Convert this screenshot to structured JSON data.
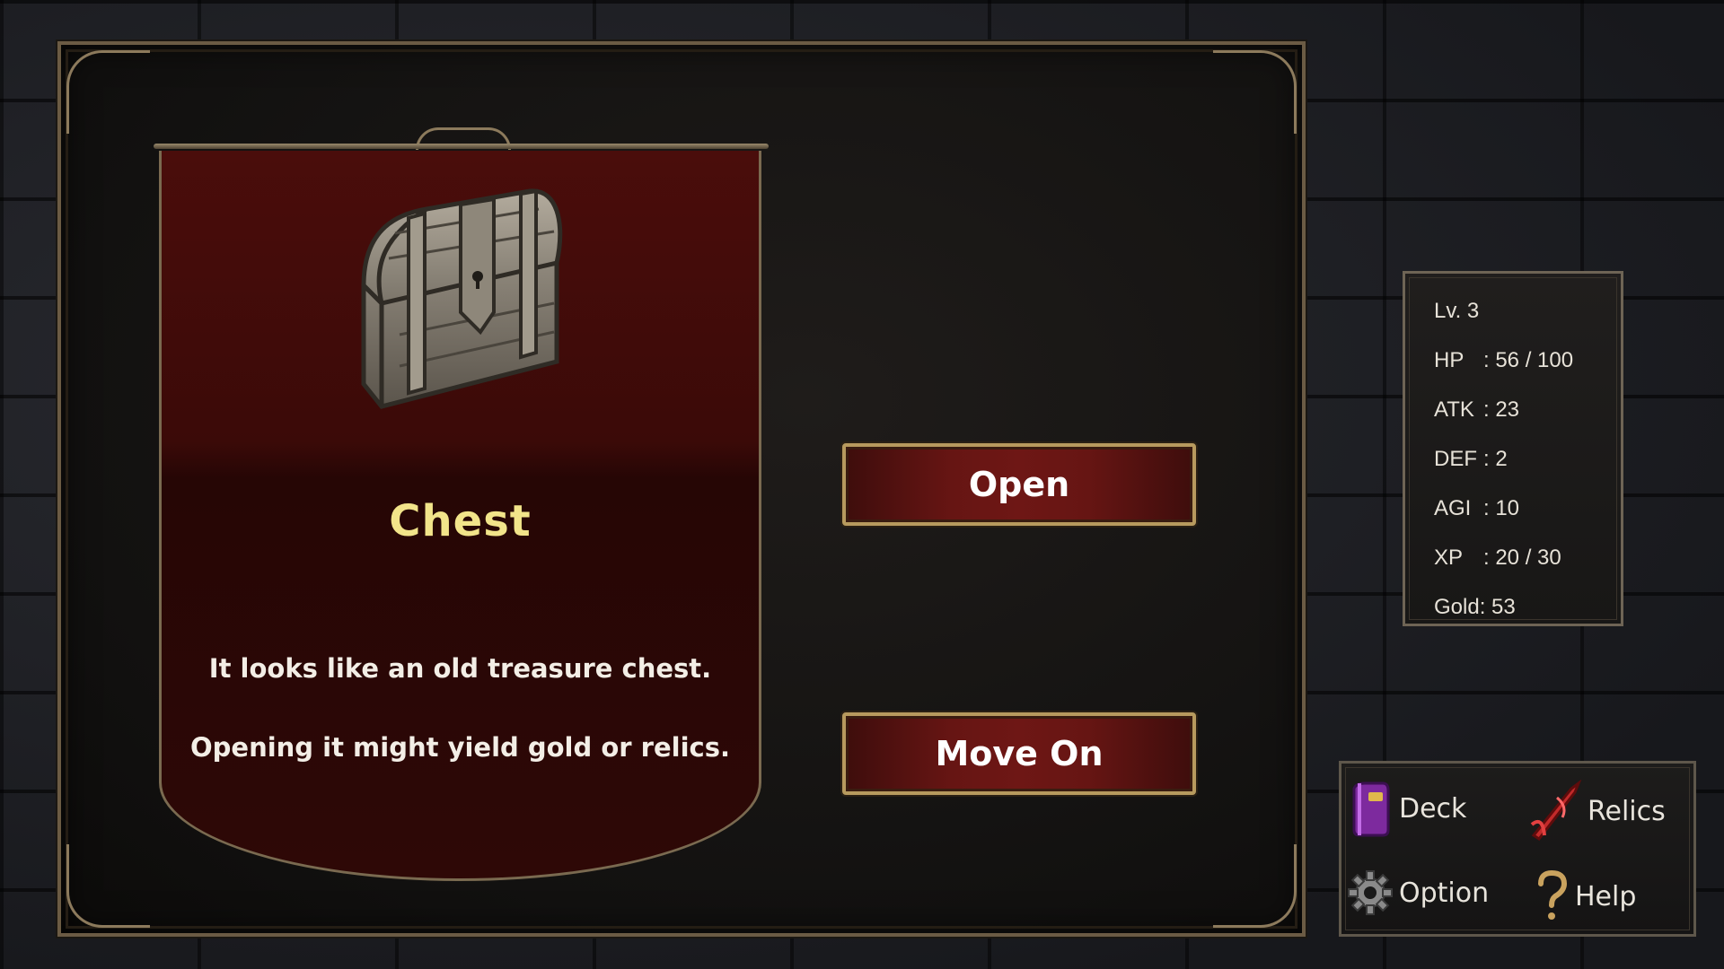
{
  "event": {
    "title": "Chest",
    "description_line1": "It looks like an old treasure chest.",
    "description_line2": "Opening it might yield gold or relics."
  },
  "choices": {
    "open_label": "Open",
    "move_on_label": "Move On"
  },
  "stats": {
    "level": "Lv. 3",
    "hp_label": "HP",
    "hp_value": ": 56 / 100",
    "atk_label": "ATK",
    "atk_value": ": 23",
    "def_label": "DEF",
    "def_value": ": 2",
    "agi_label": "AGI",
    "agi_value": ": 10",
    "xp_label": "XP",
    "xp_value": ": 20 / 30",
    "gold": "Gold: 53"
  },
  "menu": {
    "deck_label": "Deck",
    "relics_label": "Relics",
    "option_label": "Option",
    "help_label": "Help",
    "icons": [
      "deck-icon",
      "relics-icon",
      "gear-icon",
      "help-icon"
    ]
  },
  "colors": {
    "title": "#f2e48a",
    "banner": "#4a0d0b",
    "button": "#661513",
    "button_border": "#b79a5e"
  }
}
